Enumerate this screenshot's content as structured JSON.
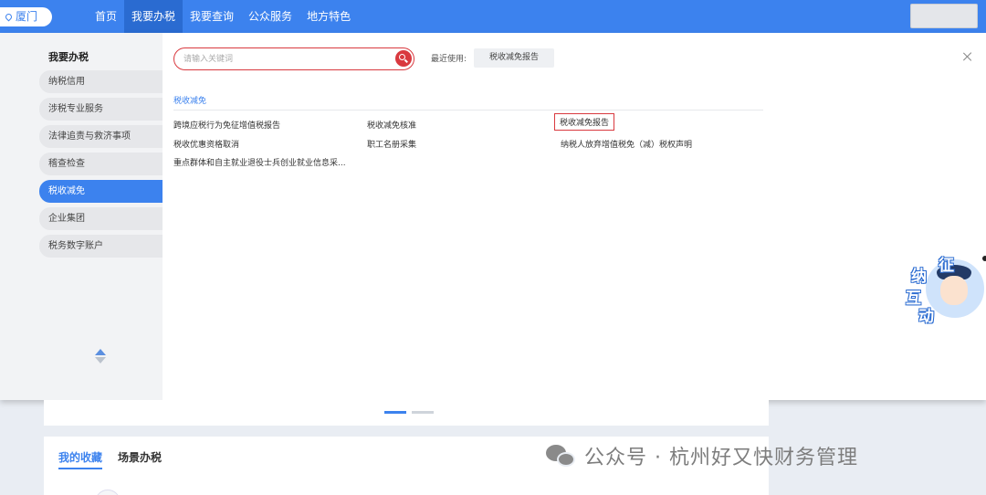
{
  "header": {
    "city": "厦门",
    "nav": [
      "首页",
      "我要办税",
      "我要查询",
      "公众服务",
      "地方特色"
    ],
    "active_nav": "我要办税"
  },
  "sidebar": {
    "title": "我要办税",
    "items": [
      {
        "label": "纳税信用"
      },
      {
        "label": "涉税专业服务"
      },
      {
        "label": "法律追责与救济事项"
      },
      {
        "label": "稽查检查"
      },
      {
        "label": "税收减免",
        "active": true
      },
      {
        "label": "企业集团"
      },
      {
        "label": "税务数字账户"
      }
    ]
  },
  "search": {
    "placeholder": "请输入关键词",
    "recent_label": "最近使用:",
    "recent_items": [
      "税收减免报告"
    ]
  },
  "section": {
    "title": "税收减免",
    "services": [
      {
        "label": "跨境应税行为免征增值税报告"
      },
      {
        "label": "税收减免核准"
      },
      {
        "label": "税收减免报告",
        "highlighted": true
      },
      {
        "label": "税收优惠资格取消"
      },
      {
        "label": "职工名册采集"
      },
      {
        "label": "纳税人放弃增值税免（减）税权声明"
      },
      {
        "label": "重点群体和自主就业退役士兵创业就业信息采..."
      }
    ]
  },
  "float_badge": {
    "chars": [
      "征",
      "纳",
      "互",
      "动"
    ]
  },
  "favorites": {
    "tabs": [
      "我的收藏",
      "场景办税"
    ],
    "active_tab": "我的收藏"
  },
  "watermark": {
    "text": "公众号 · 杭州好又快财务管理"
  },
  "colors": {
    "primary": "#3c82ee",
    "highlight": "#d9393f"
  }
}
